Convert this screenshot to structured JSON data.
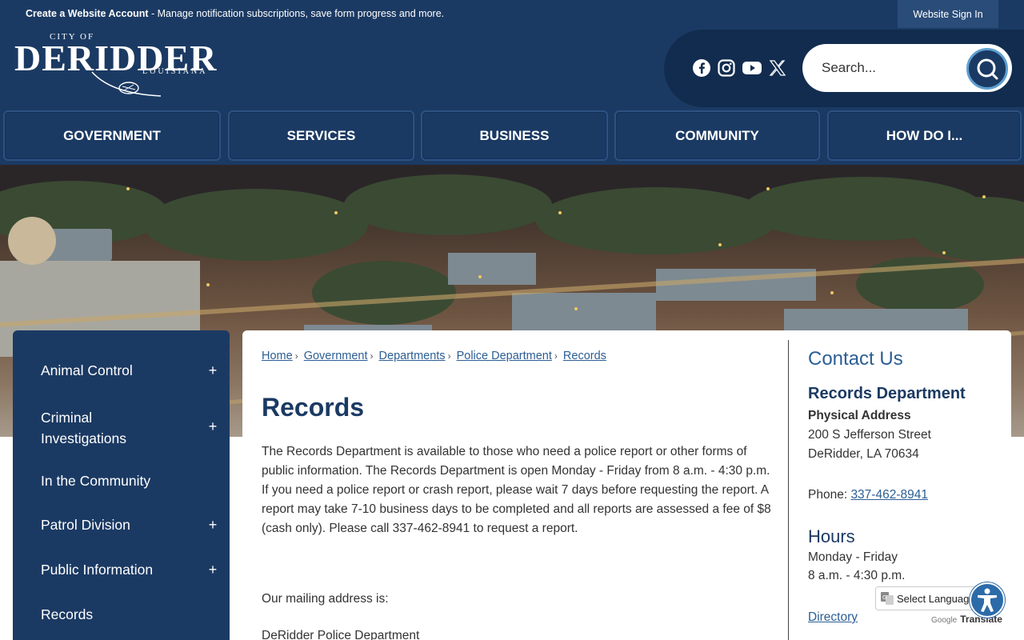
{
  "topbar": {
    "create_account": "Create a Website Account",
    "create_account_desc": " - Manage notification subscriptions, save form progress and more.",
    "sign_in": "Website Sign In"
  },
  "logo": {
    "city_of": "CITY OF",
    "name": "DERIDDER",
    "state": "LOUISIANA"
  },
  "social": [
    "facebook-icon",
    "instagram-icon",
    "youtube-icon",
    "x-icon"
  ],
  "search": {
    "placeholder": "Search..."
  },
  "nav": [
    "GOVERNMENT",
    "SERVICES",
    "BUSINESS",
    "COMMUNITY",
    "HOW DO I..."
  ],
  "sidebar": {
    "items": [
      {
        "label": "Animal Control",
        "expandable": true
      },
      {
        "label": "Criminal",
        "label2": "Investigations",
        "expandable": true
      },
      {
        "label": "In the Community",
        "expandable": false
      },
      {
        "label": "Patrol Division",
        "expandable": true
      },
      {
        "label": "Public Information",
        "expandable": true
      },
      {
        "label": "Records",
        "expandable": false
      }
    ],
    "plus": "+"
  },
  "breadcrumb": {
    "items": [
      "Home",
      "Government",
      " Departments",
      "Police Department",
      "Records"
    ],
    "sep": "›"
  },
  "page": {
    "title": "Records",
    "paragraph": "The Records Department is available to those who need a police report or other forms of public information. The Records Department is open Monday - Friday from 8 a.m. - 4:30 p.m. If you need a police report or crash report, please wait 7 days before requesting the report. A report may take 7-10 business days to be completed and all reports are assessed a fee of $8 (cash only). Please call 337-462-8941 to request a report.",
    "mailing_intro": "Our mailing address is:",
    "mailing_name": "DeRidder Police Department"
  },
  "contact": {
    "heading": "Contact Us",
    "department": "Records Department",
    "address_label": "Physical Address",
    "street": "200 S Jefferson Street",
    "city": "DeRidder, LA 70634",
    "phone_label": "Phone: ",
    "phone": "337-462-8941",
    "hours_heading": "Hours",
    "days": "Monday - Friday",
    "times": "8 a.m. - 4:30 p.m.",
    "directory": "Directory"
  },
  "translate": {
    "select": "Select Language",
    "google": "Google",
    "translate": "Translate"
  },
  "colors": {
    "navy": "#1b3a63",
    "link": "#2c5e94",
    "accent": "#5e9fd0"
  }
}
